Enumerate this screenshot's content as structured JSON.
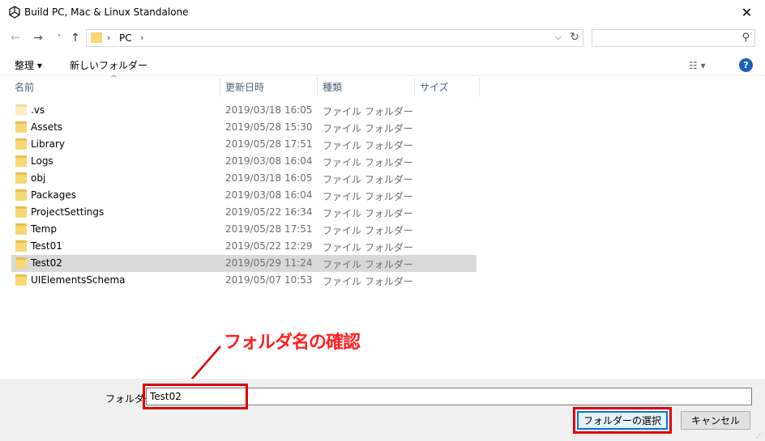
{
  "window": {
    "title": "Build PC, Mac & Linux Standalone",
    "close_glyph": "✕"
  },
  "nav": {
    "back_glyph": "←",
    "forward_glyph": "→",
    "recent_glyph": "˅",
    "up_glyph": "↑",
    "breadcrumb_sep": "›",
    "breadcrumb": "PC",
    "dropdown_glyph": "⌵",
    "refresh_glyph": "↻",
    "search_placeholder": "",
    "search_icon": "⚲"
  },
  "toolbar": {
    "organize": "整理 ▾",
    "new_folder": "新しいフォルダー",
    "view_glyph": "☷ ▾",
    "help_glyph": "?"
  },
  "columns": {
    "name": "名前",
    "date": "更新日時",
    "type": "種類",
    "size": "サイズ",
    "sort_caret": "^"
  },
  "files": [
    {
      "name": ".vs",
      "date": "2019/03/18 16:05",
      "type": "ファイル フォルダー"
    },
    {
      "name": "Assets",
      "date": "2019/05/28 15:30",
      "type": "ファイル フォルダー"
    },
    {
      "name": "Library",
      "date": "2019/05/28 17:51",
      "type": "ファイル フォルダー"
    },
    {
      "name": "Logs",
      "date": "2019/03/08 16:04",
      "type": "ファイル フォルダー"
    },
    {
      "name": "obj",
      "date": "2019/03/18 16:05",
      "type": "ファイル フォルダー"
    },
    {
      "name": "Packages",
      "date": "2019/03/08 16:04",
      "type": "ファイル フォルダー"
    },
    {
      "name": "ProjectSettings",
      "date": "2019/05/22 16:34",
      "type": "ファイル フォルダー"
    },
    {
      "name": "Temp",
      "date": "2019/05/28 17:51",
      "type": "ファイル フォルダー"
    },
    {
      "name": "Test01",
      "date": "2019/05/22 12:29",
      "type": "ファイル フォルダー"
    },
    {
      "name": "Test02",
      "date": "2019/05/29 11:24",
      "type": "ファイル フォルダー"
    },
    {
      "name": "UIElementsSchema",
      "date": "2019/05/07 10:53",
      "type": "ファイル フォルダー"
    }
  ],
  "selected_file": "Test02",
  "annotation": "フォルダ名の確認",
  "bottom": {
    "folder_label": "フォルダー:",
    "folder_value": "Test02",
    "select_button": "フォルダーの選択",
    "cancel_button": "キャンセル"
  },
  "colors": {
    "highlight_red": "#e00000",
    "selection_gray": "#d9d9d9",
    "folder_yellow": "#f8d775",
    "help_blue": "#1f5fbf"
  }
}
